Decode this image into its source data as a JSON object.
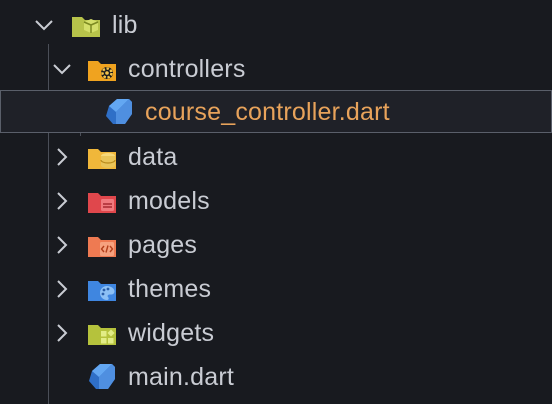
{
  "explorer": {
    "root": {
      "label": "lib",
      "icon": "lib-folder-icon",
      "expanded": true
    },
    "controllers": {
      "label": "controllers",
      "icon": "controllers-folder-icon",
      "expanded": true
    },
    "selected_file": {
      "label": "course_controller.dart",
      "icon": "dart-file-icon"
    },
    "folders": [
      {
        "label": "data",
        "icon": "data-folder-icon"
      },
      {
        "label": "models",
        "icon": "models-folder-icon"
      },
      {
        "label": "pages",
        "icon": "pages-folder-icon"
      },
      {
        "label": "themes",
        "icon": "themes-folder-icon"
      },
      {
        "label": "widgets",
        "icon": "widgets-folder-icon"
      }
    ],
    "main_file": {
      "label": "main.dart",
      "icon": "dart-file-icon"
    }
  },
  "colors": {
    "background": "#181a1f",
    "text": "#c9ccd3",
    "selected_text": "#e8a35b",
    "selection_border": "#5a5f6a",
    "dart_blue": "#4f8fe0"
  }
}
